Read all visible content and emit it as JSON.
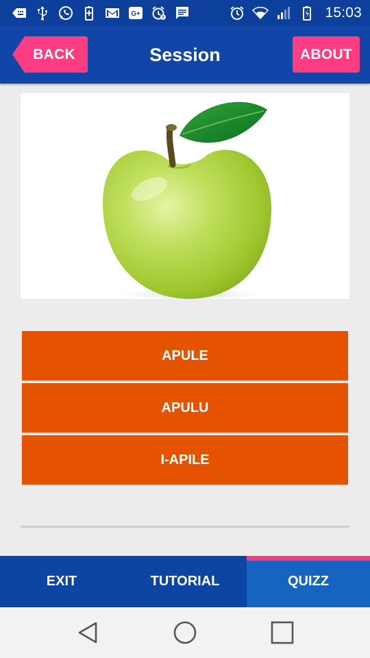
{
  "status_bar": {
    "time": "15:03",
    "icons": [
      "keyboard-back-icon",
      "usb-icon",
      "whatsapp-icon",
      "battery-saver-icon",
      "gmail-icon",
      "google-plus-icon",
      "alarm-notification-icon",
      "message-icon",
      "alarm-icon",
      "wifi-icon",
      "signal-icon",
      "battery-charging-icon"
    ]
  },
  "app_bar": {
    "title": "Session",
    "back_label": "BACK",
    "about_label": "ABOUT",
    "accent_color": "#fd3d82",
    "bar_color": "#1146a8"
  },
  "question": {
    "image": "green-apple"
  },
  "answers": [
    {
      "label": "APULE"
    },
    {
      "label": "APULU"
    },
    {
      "label": "I-APILE"
    }
  ],
  "answer_color": "#e55300",
  "tabs": [
    {
      "label": "EXIT",
      "active": false
    },
    {
      "label": "TUTORIAL",
      "active": false
    },
    {
      "label": "QUIZZ",
      "active": true
    }
  ],
  "nav": [
    "back-triangle-icon",
    "home-circle-icon",
    "recents-square-icon"
  ]
}
